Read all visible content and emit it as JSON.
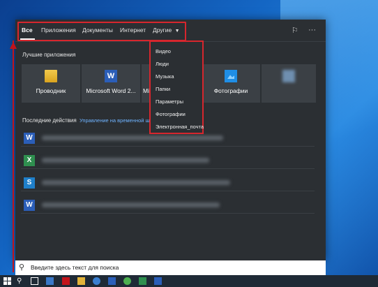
{
  "tabs": {
    "all": "Все",
    "apps": "Приложения",
    "documents": "Документы",
    "internet": "Интернет",
    "other": "Другие"
  },
  "top_apps": {
    "title": "Лучшие приложения",
    "items": [
      {
        "label": "Проводник",
        "icon": "folder-icon"
      },
      {
        "label": "Microsoft Word 2...",
        "icon": "word-icon"
      },
      {
        "label": "Mi",
        "icon": "blurred-app-icon"
      },
      {
        "label": "Фотографии",
        "icon": "photos-icon"
      },
      {
        "label": "",
        "icon": "blurred-app-icon"
      }
    ]
  },
  "recent": {
    "title": "Последние действия",
    "manage_link": "Управление на временной ш",
    "items": [
      {
        "icon": "word-icon"
      },
      {
        "icon": "excel-icon"
      },
      {
        "icon": "sway-icon"
      },
      {
        "icon": "word-icon"
      }
    ]
  },
  "dropdown": {
    "items": [
      "Видео",
      "Люди",
      "Музыка",
      "Папки",
      "Параметры",
      "Фотографии",
      "Электронная_почта"
    ]
  },
  "search": {
    "placeholder": "Введите здесь текст для поиска"
  },
  "colors": {
    "highlight": "#d7262d",
    "panel_bg": "#2b2f33",
    "link": "#6fb3ff",
    "taskbar": "#1f2a36"
  }
}
